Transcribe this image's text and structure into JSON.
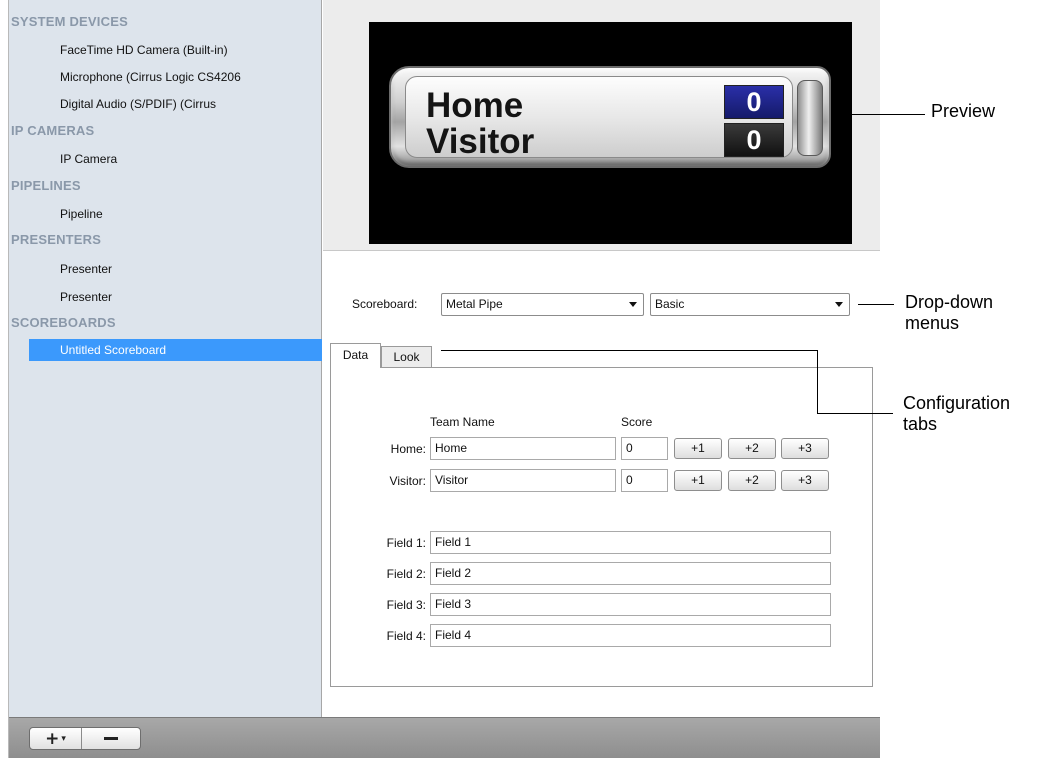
{
  "sidebar": {
    "sections": [
      {
        "title": "SYSTEM DEVICES",
        "items": [
          "FaceTime HD Camera (Built-in)",
          "Microphone (Cirrus Logic CS4206",
          "Digital Audio (S/PDIF) (Cirrus"
        ]
      },
      {
        "title": "IP CAMERAS",
        "items": [
          "IP Camera"
        ]
      },
      {
        "title": "PIPELINES",
        "items": [
          "Pipeline"
        ]
      },
      {
        "title": "PRESENTERS",
        "items": [
          "Presenter",
          "Presenter"
        ]
      },
      {
        "title": "SCOREBOARDS",
        "items": [
          "Untitled Scoreboard"
        ]
      }
    ],
    "selected_item": "Untitled Scoreboard"
  },
  "bottom_bar": {
    "add_label": "+",
    "add_caret": "▾"
  },
  "preview": {
    "home_name": "Home",
    "visitor_name": "Visitor",
    "home_score": "0",
    "visitor_score": "0"
  },
  "selectors": {
    "label": "Scoreboard:",
    "style_value": "Metal Pipe",
    "variant_value": "Basic"
  },
  "tabs": [
    {
      "label": "Data",
      "active": true
    },
    {
      "label": "Look",
      "active": false
    }
  ],
  "data_tab": {
    "col_team_name": "Team Name",
    "col_score": "Score",
    "home_label": "Home:",
    "visitor_label": "Visitor:",
    "home_team": "Home",
    "visitor_team": "Visitor",
    "home_score": "0",
    "visitor_score": "0",
    "score_buttons": [
      "+1",
      "+2",
      "+3"
    ],
    "fields": [
      {
        "label": "Field 1:",
        "value": "Field 1"
      },
      {
        "label": "Field 2:",
        "value": "Field 2"
      },
      {
        "label": "Field 3:",
        "value": "Field 3"
      },
      {
        "label": "Field 4:",
        "value": "Field 4"
      }
    ]
  },
  "callouts": {
    "preview": "Preview",
    "dropdowns_line1": "Drop-down",
    "dropdowns_line2": "menus",
    "tabs_line1": "Configuration",
    "tabs_line2": "tabs"
  }
}
